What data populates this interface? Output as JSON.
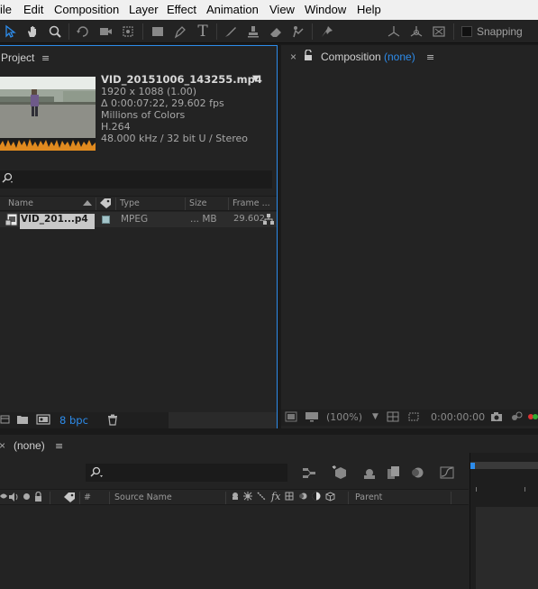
{
  "menu": {
    "items": [
      "ile",
      "Edit",
      "Composition",
      "Layer",
      "Effect",
      "Animation",
      "View",
      "Window",
      "Help"
    ]
  },
  "toolbar": {
    "tools": [
      "selection-tool-icon",
      "hand-tool-icon",
      "zoom-tool-icon",
      "rotation-tool-icon",
      "camera-tool-icon",
      "pan-behind-tool-icon",
      "rectangle-tool-icon",
      "pen-tool-icon",
      "type-tool-icon",
      "brush-tool-icon",
      "clone-stamp-tool-icon",
      "eraser-tool-icon",
      "roto-brush-tool-icon",
      "puppet-pin-tool-icon",
      "local-axis-icon",
      "world-axis-icon",
      "view-axis-icon"
    ],
    "snapping_label": "Snapping"
  },
  "project": {
    "tab_label": "Project",
    "menu_icon": "≡",
    "selected_file": {
      "name": "VID_20151006_143255.mp4",
      "dims": "1920 x 1088 (1.00)",
      "duration": "Δ 0:00:07:22, 29.602 fps",
      "colors": "Millions of Colors",
      "codec": "H.264",
      "audio": "48.000 kHz / 32 bit U / Stereo"
    },
    "columns": {
      "name": "Name",
      "type": "Type",
      "size": "Size",
      "frame": "Frame ..."
    },
    "rows": [
      {
        "name": "VID_201...p4",
        "type": "MPEG",
        "size": "... MB",
        "frame": "29.602"
      }
    ],
    "footer": {
      "bpc": "8 bpc"
    },
    "colors": {
      "accent": "#2d8ceb",
      "label_swatch": "#a3c4c9"
    }
  },
  "composition": {
    "close_label": "×",
    "tab_label": "Composition",
    "tab_value": "(none)",
    "menu_icon": "≡",
    "footer": {
      "zoom": "(100%)",
      "timecode": "0:00:00:00"
    }
  },
  "timeline": {
    "close_label": "×",
    "tab_label": "(none)",
    "menu_icon": "≡",
    "columns": {
      "source_name": "Source Name",
      "hash": "#",
      "parent": "Parent"
    }
  }
}
